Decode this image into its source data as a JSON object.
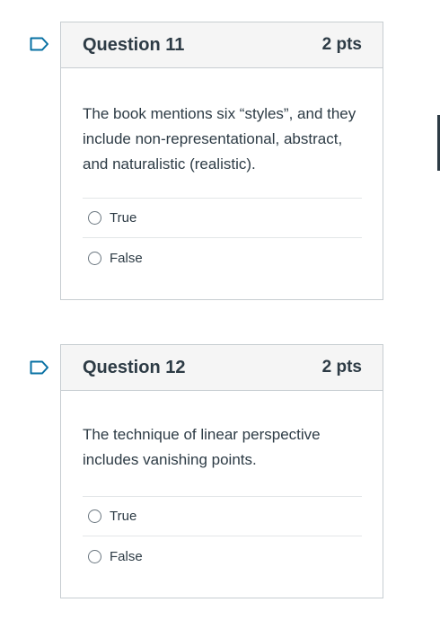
{
  "questions": [
    {
      "title": "Question 11",
      "points": "2 pts",
      "text": "The book mentions six “styles”, and they include non-representational, abstract, and naturalistic (realistic).",
      "answers": [
        "True",
        "False"
      ]
    },
    {
      "title": "Question 12",
      "points": "2 pts",
      "text": "The technique of linear perspective includes vanishing points.",
      "answers": [
        "True",
        "False"
      ]
    }
  ],
  "icons": {
    "flag": "flag-icon",
    "radio": "radio-unchecked-icon"
  },
  "colors": {
    "accent": "#0770a3",
    "text": "#2d3b45",
    "header_bg": "#f5f5f5",
    "border": "#c7cdd1"
  }
}
